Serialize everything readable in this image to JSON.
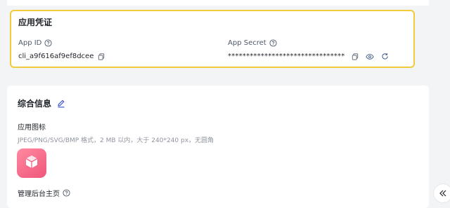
{
  "credentials": {
    "title": "应用凭证",
    "app_id_label": "App ID",
    "app_id_value": "cli_a9f616af9ef8dcee",
    "app_secret_label": "App Secret",
    "app_secret_value": "********************************"
  },
  "info": {
    "title": "综合信息",
    "app_icon_label": "应用图标",
    "app_icon_hint": "JPEG/PNG/SVG/BMP 格式，2 MB 以内，大于 240*240 px，无圆角",
    "admin_home_label": "管理后台主页"
  },
  "colors": {
    "highlight_border": "#f1cb3b",
    "app_icon_gradient": [
      "#ff8aa0",
      "#f0557a"
    ],
    "link_blue": "#3370ff"
  },
  "icons": [
    "help-icon",
    "copy-icon",
    "eye-icon",
    "refresh-icon",
    "edit-icon",
    "app-cube-icon",
    "double-chevron-left-icon"
  ]
}
